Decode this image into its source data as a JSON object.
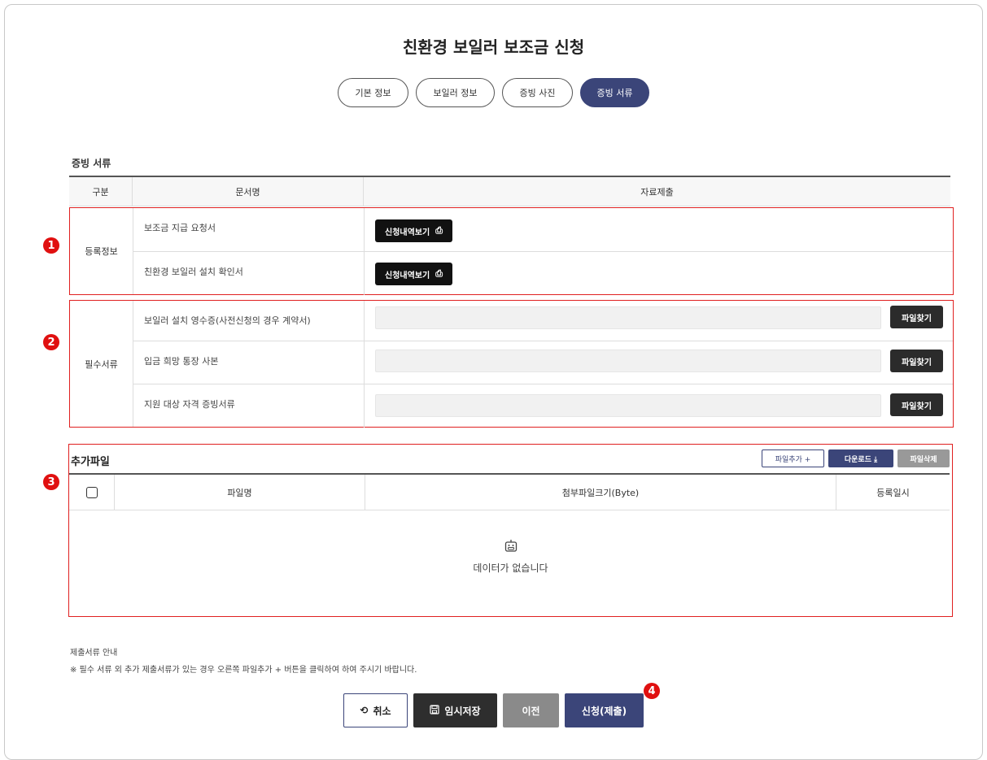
{
  "page": {
    "title": "친환경 보일러 보조금 신청"
  },
  "tabs": [
    {
      "label": "기본 정보",
      "active": false
    },
    {
      "label": "보일러 정보",
      "active": false
    },
    {
      "label": "증빙 사진",
      "active": false
    },
    {
      "label": "증빙 서류",
      "active": true
    }
  ],
  "documents": {
    "section_title": "증빙 서류",
    "headers": {
      "category": "구분",
      "doc_name": "문서명",
      "submission": "자료제출"
    },
    "registration": {
      "category": "등록정보",
      "marker": "1",
      "rows": [
        {
          "name": "보조금 지급 요청서",
          "button": "신청내역보기"
        },
        {
          "name": "친환경 보일러 설치 확인서",
          "button": "신청내역보기"
        }
      ]
    },
    "required": {
      "category": "필수서류",
      "marker": "2",
      "rows": [
        {
          "name": "보일러 설치 영수증(사전신청의 경우 계약서)",
          "file_value": "",
          "button": "파일찾기"
        },
        {
          "name": "입금 희망 통장 사본",
          "file_value": "",
          "button": "파일찾기"
        },
        {
          "name": "지원 대상 자격 증빙서류",
          "file_value": "",
          "button": "파일찾기"
        }
      ]
    }
  },
  "extra_files": {
    "title": "추가파일",
    "marker": "3",
    "buttons": {
      "add": "파일추가 +",
      "download": "다운로드 ⤓",
      "delete": "파일삭제"
    },
    "headers": {
      "file_name": "파일명",
      "file_size": "첨부파일크기(Byte)",
      "date": "등록일시"
    },
    "empty_message": "데이터가 없습니다"
  },
  "notice": {
    "title": "제출서류 안내",
    "text": "※ 필수 서류 외 추가 제출서류가 있는 경우 오른쪽 파일추가 + 버튼을 클릭하여 하여 주시기 바랍니다."
  },
  "actions": {
    "cancel": "취소",
    "save": "임시저장",
    "prev": "이전",
    "submit": "신청(제출)",
    "marker": "4"
  },
  "colors": {
    "accent": "#3b4579",
    "marker": "#e01010",
    "highlight_border": "#e02020"
  }
}
